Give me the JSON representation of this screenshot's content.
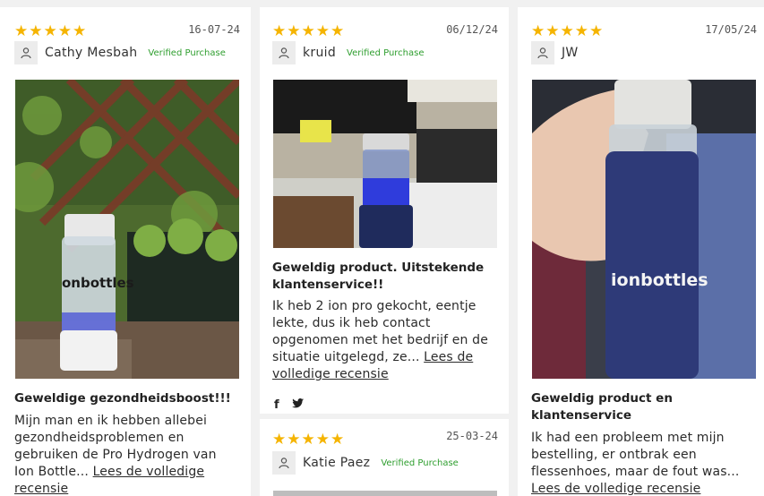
{
  "colors": {
    "star": "#f5b400",
    "verified": "#2e9e2e",
    "card_bg": "#ffffff",
    "page_bg": "#f1f1f1"
  },
  "icons": {
    "star": "★",
    "user": "user-icon",
    "facebook": "f",
    "twitter": "twitter-icon"
  },
  "reviews": [
    {
      "rating": 5,
      "date": "16-07-24",
      "author": "Cathy Mesbah",
      "verified": "Verified Purchase",
      "title": "Geweldige gezondheidsboost!!!",
      "body": "Mijn man en ik hebben allebei gezondheidsproblemen en gebruiken de Pro Hydrogen van Ion Bottle...",
      "link": "Lees de volledige recensie",
      "photo_text": "onbottles"
    },
    {
      "rating": 5,
      "date": "06/12/24",
      "author": "kruid",
      "verified": "Verified Purchase",
      "title": "Geweldig product. Uitstekende klantenservice!!",
      "body": "Ik heb 2 ion pro gekocht, eentje lekte, dus ik heb contact opgenomen met het bedrijf en de situatie uitgelegd, ze...",
      "link": "Lees de volledige recensie"
    },
    {
      "rating": 5,
      "date": "17/05/24",
      "author": "JW",
      "verified": "",
      "title": "Geweldig product en klantenservice",
      "body": "Ik had een probleem met mijn bestelling, er ontbrak een flessenhoes, maar de fout was...",
      "link": "Lees de volledige recensie",
      "photo_text": "ionbottles"
    },
    {
      "rating": 5,
      "date": "25-03-24",
      "author": "Katie Paez",
      "verified": "Verified Purchase"
    }
  ]
}
